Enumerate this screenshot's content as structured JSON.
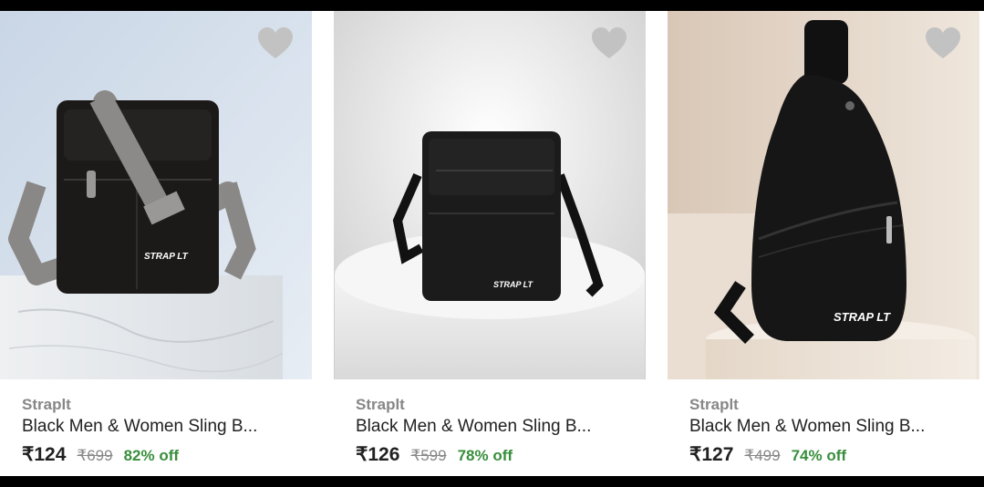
{
  "products": [
    {
      "brand": "Straplt",
      "title": "Black Men & Women Sling B...",
      "price": "₹124",
      "mrp": "₹699",
      "discount": "82% off",
      "logo_text": "STRAP LT",
      "image_icon": "sling-bag-image",
      "wishlist_icon": "heart-icon"
    },
    {
      "brand": "Straplt",
      "title": "Black Men & Women Sling B...",
      "price": "₹126",
      "mrp": "₹599",
      "discount": "78% off",
      "logo_text": "STRAP LT",
      "image_icon": "sling-bag-image",
      "wishlist_icon": "heart-icon"
    },
    {
      "brand": "Straplt",
      "title": "Black Men & Women Sling B...",
      "price": "₹127",
      "mrp": "₹499",
      "discount": "74% off",
      "logo_text": "STRAP LT",
      "image_icon": "chest-sling-bag-image",
      "wishlist_icon": "heart-icon"
    }
  ],
  "colors": {
    "discount": "#388e3c",
    "brand": "#878787",
    "title": "#212121"
  }
}
